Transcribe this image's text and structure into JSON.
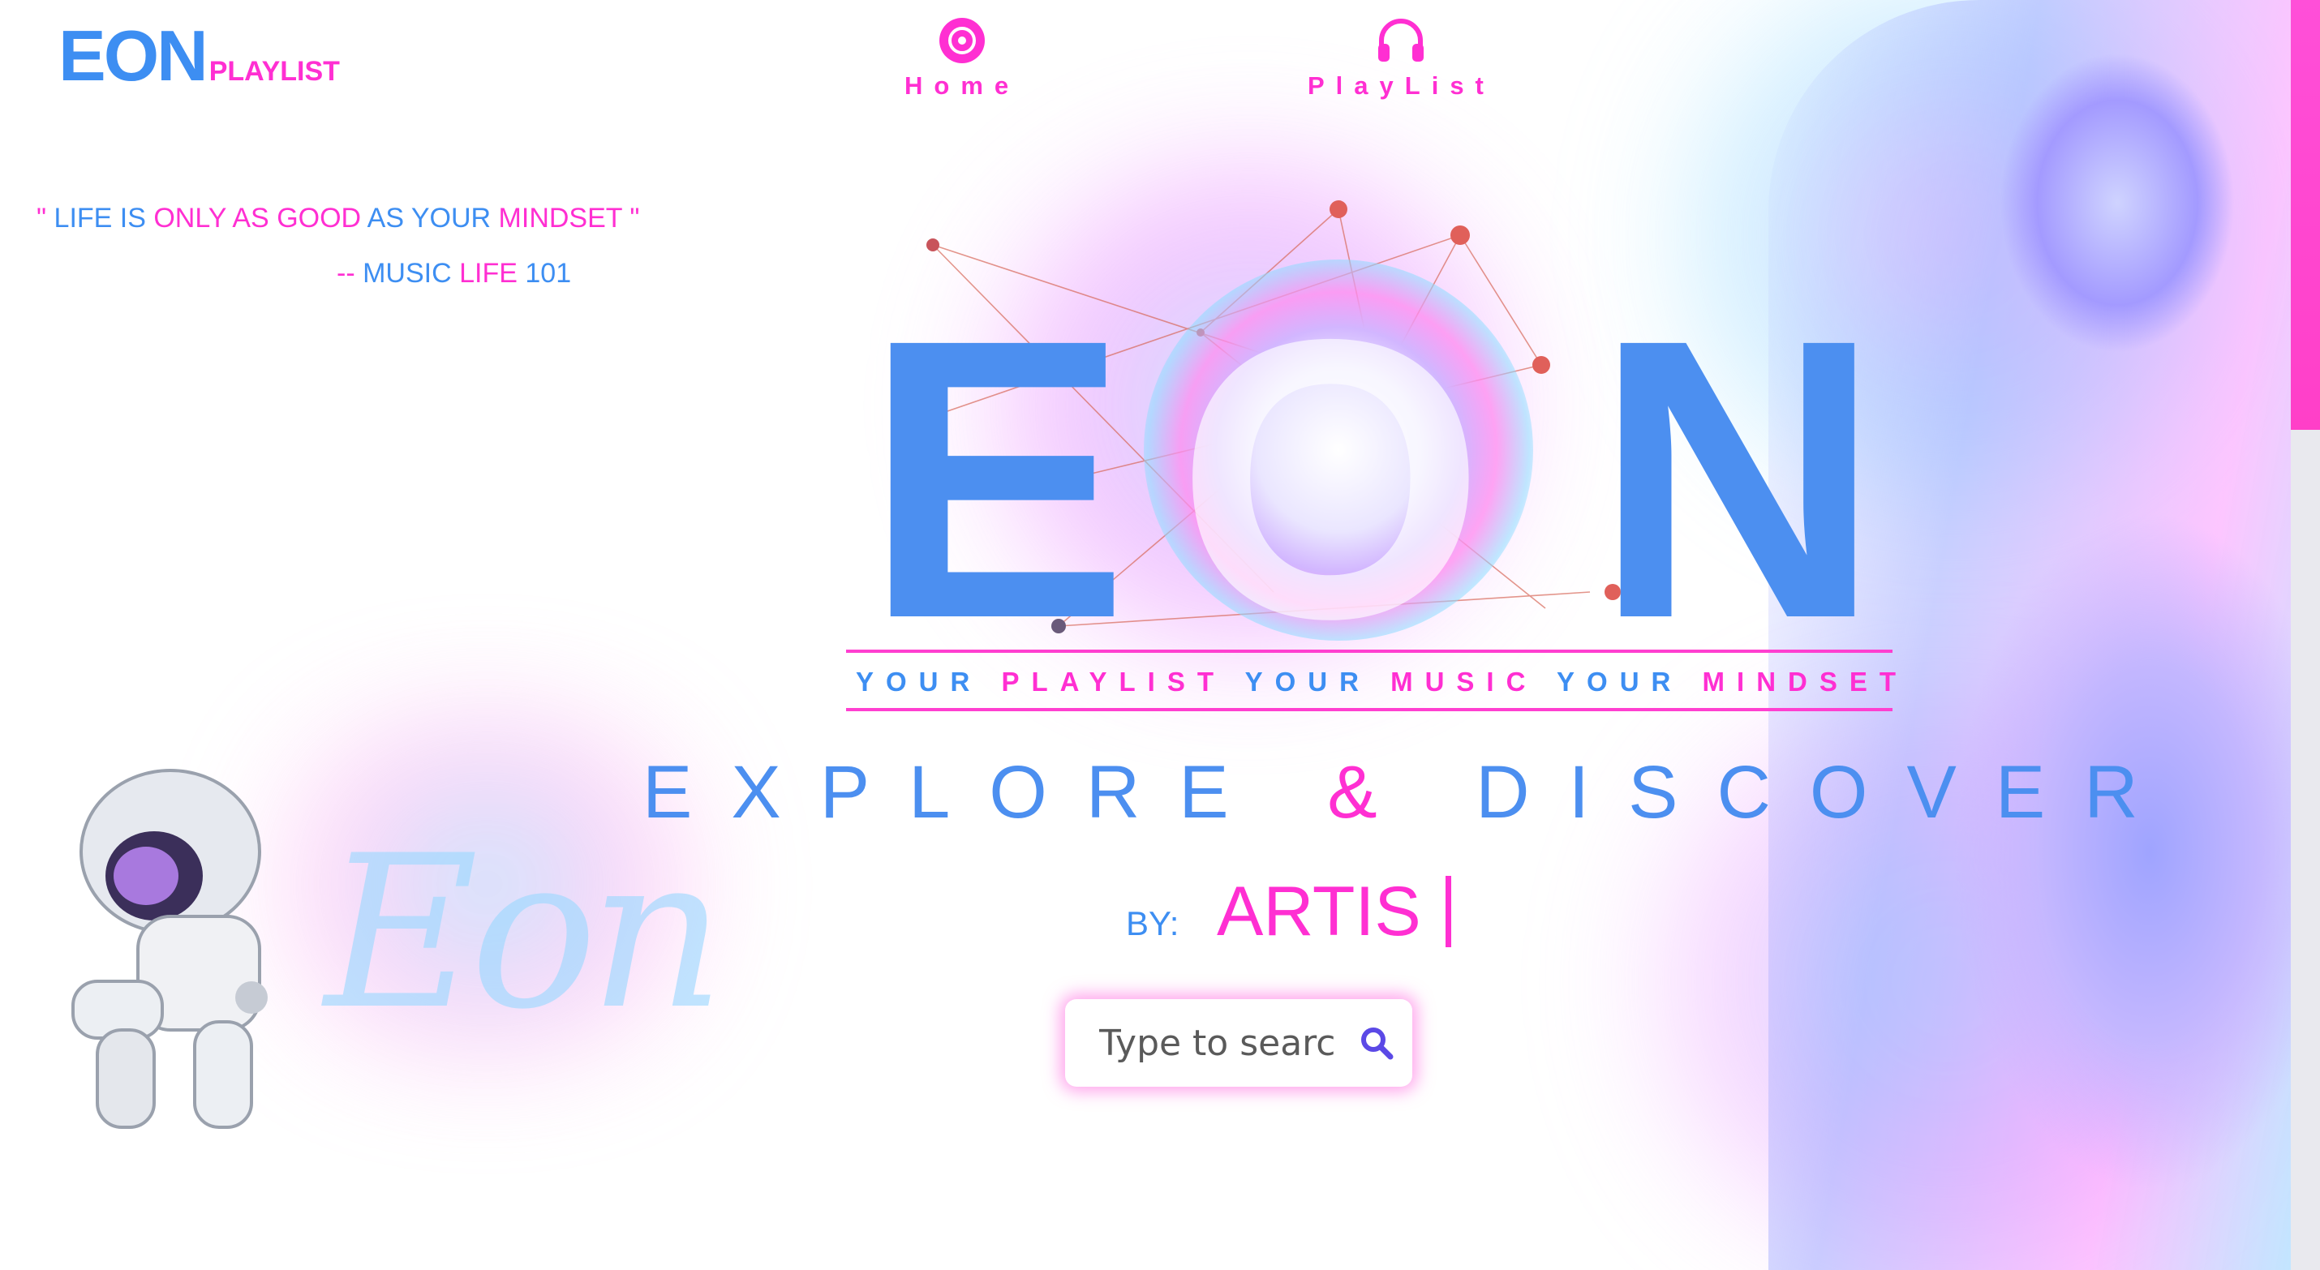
{
  "header": {
    "logo_main": "EON",
    "logo_sub": "PLAYLIST",
    "nav": [
      {
        "label": "Home",
        "icon": "disc-icon"
      },
      {
        "label": "PlayList",
        "icon": "headphones-icon"
      }
    ]
  },
  "quote": {
    "open": "\"",
    "w1": "LIFE IS",
    "w2": "ONLY AS",
    "w3": "GOOD",
    "w4": "AS YOUR",
    "w5": "MINDSET",
    "close": "\"",
    "attrib_dash": "--",
    "attrib_w1": "MUSIC",
    "attrib_w2": "LIFE",
    "attrib_w3": "101"
  },
  "hero": {
    "letter_e": "E",
    "letter_o": "O",
    "letter_n": "N",
    "tagline_w1": "YOUR",
    "tagline_w2": "PLAYLIST",
    "tagline_w3": "YOUR",
    "tagline_w4": "MUSIC",
    "tagline_w5": "YOUR",
    "tagline_w6": "MINDSET",
    "explore_a": "EXPLORE",
    "explore_amp": "&",
    "explore_b": "DISCOVER",
    "by_label": "BY:",
    "artist": "ARTIS"
  },
  "decor": {
    "script_logo": "Eon"
  },
  "search": {
    "placeholder": "Type to search...",
    "icon": "search-icon"
  },
  "colors": {
    "blue": "#3d8ef2",
    "pink": "#ff2fd2"
  }
}
